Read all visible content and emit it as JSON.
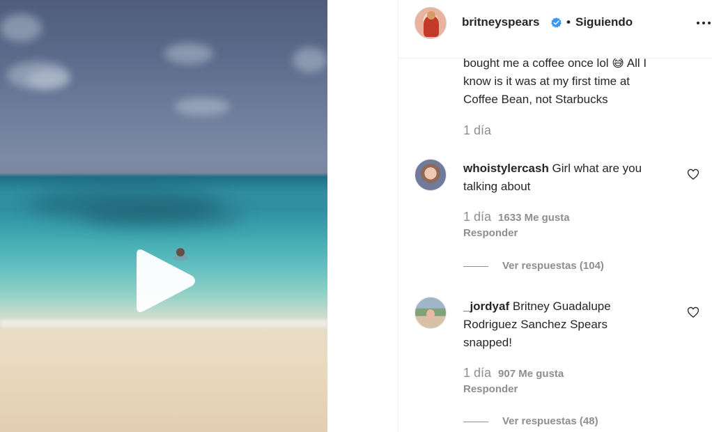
{
  "post": {
    "media_type": "video",
    "play_icon": "play-icon"
  },
  "header": {
    "username": "britneyspears",
    "verified_icon": "verified-badge-icon",
    "separator": "•",
    "follow_status": "Siguiendo",
    "more_icon": "more-options-icon"
  },
  "comments": [
    {
      "text_partial": "bought me a coffee once lol 😅 All I know is it was at my first time at Coffee Bean, not Starbucks",
      "line1": "bought me a coffee once lol 😅 All I",
      "line2": "know is it was at my first time at",
      "line3": "Coffee Bean, not Starbucks",
      "time": "1 día"
    },
    {
      "username": "whoistylercash",
      "text": " Girl what are you",
      "text_line2": "talking about",
      "time": "1 día",
      "likes": "1633 Me gusta",
      "reply": "Responder",
      "view_replies": "Ver respuestas (104)",
      "heart_icon": "heart-outline-icon"
    },
    {
      "username": "_jordyaf",
      "text": " Britney Guadalupe",
      "text_line2": "Rodriguez Sanchez Spears",
      "text_line3": "snapped!",
      "time": "1 día",
      "likes": "907 Me gusta",
      "reply": "Responder",
      "view_replies": "Ver respuestas (48)",
      "heart_icon": "heart-outline-icon"
    }
  ],
  "colors": {
    "text": "#262626",
    "muted": "#8e8e8e",
    "verified": "#3897f0",
    "border": "#efefef"
  }
}
